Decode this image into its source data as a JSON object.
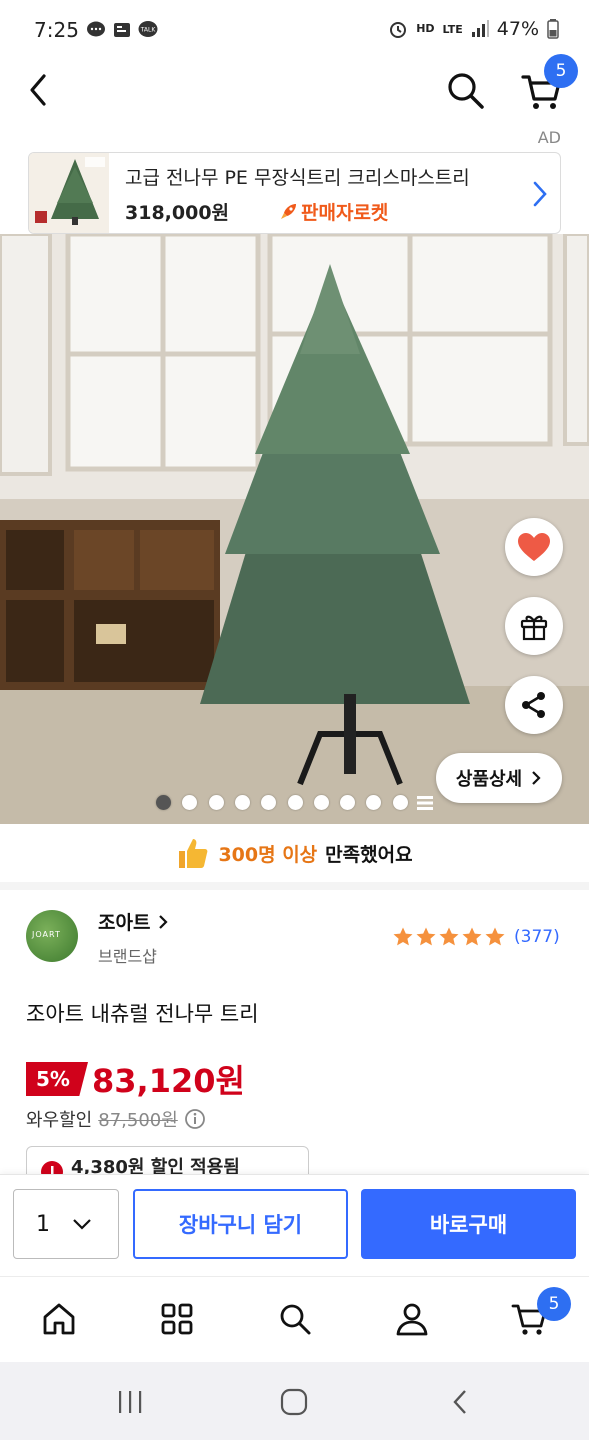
{
  "status_bar": {
    "time": "7:25",
    "battery": "47%",
    "hd": "HD",
    "lte": "LTE"
  },
  "header": {
    "cart_count": "5"
  },
  "ad": {
    "label": "AD",
    "title": "고급 전나무 PE 무장식트리 크리스마스트리",
    "price": "318,000원",
    "badge": "판매자로켓"
  },
  "hero": {
    "detail_button": "상품상세",
    "image_count": 10,
    "active_index": 0
  },
  "satisfaction": {
    "highlight": "300명 이상",
    "rest": "만족했어요"
  },
  "brand": {
    "name": "조아트",
    "sub": "브랜드샵",
    "logo_text": "JOART",
    "rating_stars": 5,
    "review_count": "(377)"
  },
  "product": {
    "title": "조아트 내츄럴 전나무 트리",
    "discount": "5%",
    "price": "83,120원",
    "wow_label": "와우할인",
    "original_price": "87,500원",
    "coupon_text": "4,380원 할인 적용됨"
  },
  "buy_bar": {
    "quantity": "1",
    "cart_button": "장바구니 담기",
    "buy_button": "바로구매"
  },
  "bottom_nav": {
    "cart_count": "5"
  },
  "colors": {
    "accent": "#346aff",
    "price_red": "#d0021b",
    "rocket_orange": "#f05a1a",
    "highlight_orange": "#e67616",
    "star": "#f5913d"
  }
}
